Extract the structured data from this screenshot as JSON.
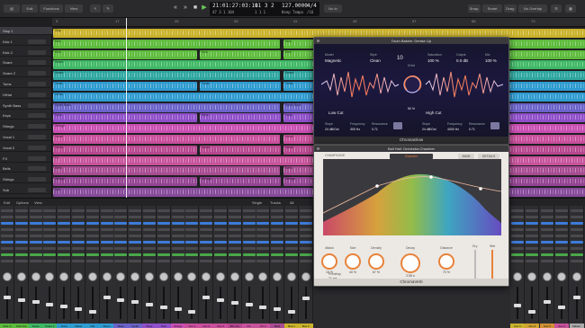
{
  "topbar": {
    "left_buttons": [
      "Edit",
      "Functions",
      "View"
    ],
    "lcd": {
      "position": "21:01:27:03:10",
      "bars": "47  3  1  104",
      "sub_pos": "11  3  2",
      "sub_pos2": "1  1  1",
      "tempo": "127.0000",
      "tempo_label": "Keep Tempo",
      "signature": "4/4",
      "key": "No In",
      "division": "/16"
    },
    "right_buttons": [
      "Snap:",
      "Smart",
      "Drag:",
      "No Overlap"
    ]
  },
  "ruler": {
    "marks": [
      "9",
      "17",
      "25",
      "33",
      "41",
      "49",
      "57",
      "65",
      "73"
    ]
  },
  "tracks": [
    {
      "name": "Slap 1",
      "color": "#c9b22b",
      "region": "Slap",
      "active": true
    },
    {
      "name": "Kick 1",
      "color": "#5dbb3c",
      "region": "Kick"
    },
    {
      "name": "Kick 2",
      "color": "#5dbb3c",
      "region": "Kick"
    },
    {
      "name": "Snare",
      "color": "#3fb865",
      "region": "Snare"
    },
    {
      "name": "Snare 2",
      "color": "#2fa7a0",
      "region": "Snare"
    },
    {
      "name": "Toms",
      "color": "#2e9bd0",
      "region": "Toms"
    },
    {
      "name": "HiHat",
      "color": "#2e9bd0",
      "region": "HiHat"
    },
    {
      "name": "Synth Bass",
      "color": "#6b63c9",
      "region": "Synth Bass"
    },
    {
      "name": "Keys",
      "color": "#8f4fc9",
      "region": "Keys"
    },
    {
      "name": "Strings",
      "color": "#c94fb3",
      "region": "Strings"
    },
    {
      "name": "Vocal 1",
      "color": "#c94f9c",
      "region": "Vocal"
    },
    {
      "name": "Vocal 2",
      "color": "#b8478f",
      "region": "Vocal"
    },
    {
      "name": "FX",
      "color": "#c7539b",
      "region": "FX"
    },
    {
      "name": "Bells",
      "color": "#a84c92",
      "region": "Bells"
    },
    {
      "name": "Strings",
      "color": "#944493",
      "region": "Strings"
    },
    {
      "name": "Sub",
      "color": "#864a9a",
      "region": "Sub"
    }
  ],
  "mixer": {
    "bar": [
      "Edit",
      "Options",
      "View",
      "Single",
      "Tracks",
      "All"
    ],
    "strips": [
      {
        "label": "Kick In",
        "color": "#5dbb3c"
      },
      {
        "label": "Kick Out",
        "color": "#5dbb3c"
      },
      {
        "label": "Snare",
        "color": "#3fb865"
      },
      {
        "label": "Snare 2",
        "color": "#3fb865"
      },
      {
        "label": "Toms",
        "color": "#2e9bd0"
      },
      {
        "label": "HiHat",
        "color": "#2e9bd0"
      },
      {
        "label": "OH",
        "color": "#2e9bd0"
      },
      {
        "label": "Room",
        "color": "#2e9bd0"
      },
      {
        "label": "Bass",
        "color": "#6b63c9"
      },
      {
        "label": "Synth",
        "color": "#6b63c9"
      },
      {
        "label": "Keys",
        "color": "#8f4fc9"
      },
      {
        "label": "Pad",
        "color": "#8f4fc9"
      },
      {
        "label": "Strings",
        "color": "#c94fb3"
      },
      {
        "label": "Vox 1",
        "color": "#c94f9c"
      },
      {
        "label": "Vox 2",
        "color": "#c94f9c"
      },
      {
        "label": "Vox 3",
        "color": "#c94f9c"
      },
      {
        "label": "BG Vox",
        "color": "#b8478f"
      },
      {
        "label": "FX",
        "color": "#c7539b"
      },
      {
        "label": "FX 2",
        "color": "#c7539b"
      },
      {
        "label": "Bells",
        "color": "#a84c92"
      },
      {
        "label": "Bus 1",
        "color": "#c9b22b"
      },
      {
        "label": "Bus 2",
        "color": "#c9b22b"
      }
    ],
    "right_strips": [
      {
        "label": "Aux 1",
        "color": "#c9b22b"
      },
      {
        "label": "Aux 2",
        "color": "#d0a230"
      },
      {
        "label": "Aux 3",
        "color": "#d18f35"
      },
      {
        "label": "Aux 4",
        "color": "#c7539b"
      },
      {
        "label": "Master",
        "color": "#aaaaaa"
      }
    ]
  },
  "phat_plugin": {
    "title": "Drum Bakein: Denise Up",
    "footer": "ChromaGlow",
    "model_label": "Model",
    "model": "Magnetic",
    "style_label": "Style",
    "style": "Clean",
    "drive_label": "Drive",
    "drive": "50 %",
    "drive_big": "10",
    "saturation_label": "Saturation",
    "saturation": "100 %",
    "output_label": "Output",
    "output": "0.0 dB",
    "mix_label": "Mix",
    "mix": "100 %",
    "low_cut": "Low Cut",
    "high_cut": "High Cut",
    "lc_slope_label": "Slope",
    "lc_slope": "24 dB/Oct",
    "lc_freq_label": "Frequency",
    "lc_freq": "300 Hz",
    "lc_res_label": "Resonance",
    "lc_res": "0.71",
    "hc_slope": "24 dB/Oct",
    "hc_freq": "4000 Hz",
    "hc_res": "0.71"
  },
  "verb_plugin": {
    "title": "Ball Hall: Orchestra Chamber",
    "footer": "ChromaVerb",
    "room_label": "CHAMPAGNE",
    "preset": "Chamber",
    "tab_main": "MAIN",
    "tab_details": "DETAILS",
    "knobs": [
      {
        "label": "Attack",
        "value": "15 %"
      },
      {
        "label": "Size",
        "value": "40 %"
      },
      {
        "label": "Density",
        "value": "67 %"
      },
      {
        "label": "Decay",
        "value": "2.55 s"
      },
      {
        "label": "Distance",
        "value": "70 %"
      }
    ],
    "predelay_label": "Predelay",
    "predelay": "21 ms",
    "dry_label": "Dry",
    "wet_label": "Wet"
  }
}
